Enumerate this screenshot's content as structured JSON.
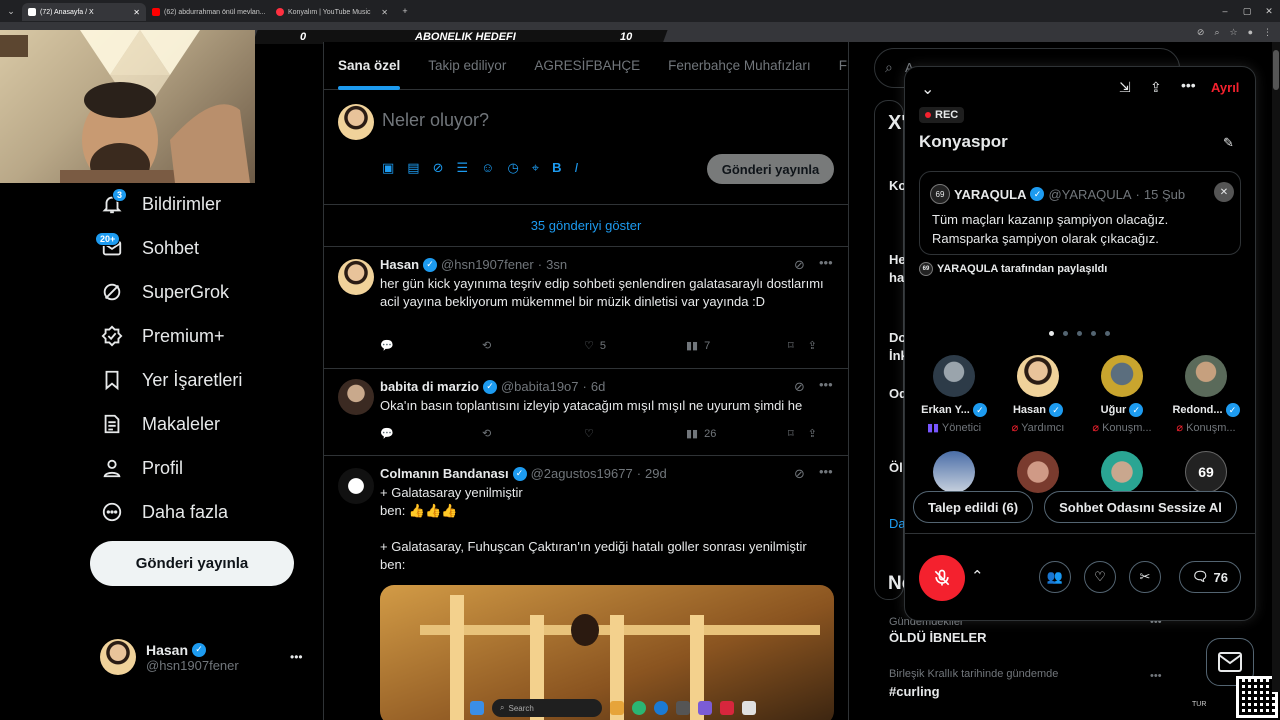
{
  "browser": {
    "tabs": [
      {
        "label": "(72) Anasayfa / X",
        "color": "#ffffff",
        "active": true
      },
      {
        "label": "(62) abdurrahman önül mevlan...",
        "color": "#ff0000",
        "active": false
      },
      {
        "label": "Konyalım | YouTube Music",
        "color": "#ff3040",
        "active": false
      }
    ]
  },
  "overlay": {
    "goal_left": "0",
    "goal_title": "ABONELIK HEDEFI",
    "goal_right": "10"
  },
  "nav": {
    "items": [
      {
        "label": "Bildirimler",
        "icon": "bell-icon",
        "badge": "3"
      },
      {
        "label": "Sohbet",
        "icon": "mail-icon",
        "badge": "20+"
      },
      {
        "label": "SuperGrok",
        "icon": "grok-icon",
        "badge": ""
      },
      {
        "label": "Premium+",
        "icon": "premium-icon",
        "badge": ""
      },
      {
        "label": "Yer İşaretleri",
        "icon": "bookmark-icon",
        "badge": ""
      },
      {
        "label": "Makaleler",
        "icon": "article-icon",
        "badge": ""
      },
      {
        "label": "Profil",
        "icon": "person-icon",
        "badge": ""
      },
      {
        "label": "Daha fazla",
        "icon": "more-circle-icon",
        "badge": ""
      }
    ],
    "post_button": "Gönderi yayınla",
    "account": {
      "name": "Hasan",
      "handle": "@hsn1907fener",
      "more": "•••"
    }
  },
  "main": {
    "tabs": [
      "Sana özel",
      "Takip ediliyor",
      "AGRESİFBAHÇE",
      "Fenerbahçe Muhafızları",
      "FE"
    ],
    "composer": {
      "placeholder": "Neler oluyor?",
      "post_button": "Gönderi yayınla"
    },
    "show_more": "35 gönderiyi göster",
    "posts": [
      {
        "name": "Hasan",
        "handle": "@hsn1907fener",
        "time": "3sn",
        "text": "her gün kick yayınıma teşriv edip sohbeti şenlendiren galatasaraylı dostlarımı acil yayına bekliyorum mükemmel bir müzik dinletisi var yayında :D",
        "likes": "5",
        "views": "7"
      },
      {
        "name": "babita di marzio",
        "handle": "@babita19o7",
        "time": "6d",
        "text": "Oka'ın basın toplantısını izleyip yatacağım mışıl mışıl ne uyurum şimdi he",
        "likes": "",
        "views": "26"
      },
      {
        "name": "Colmanın Bandanası",
        "handle": "@2agustos19677",
        "time": "29d",
        "text": "+ Galatasaray yenilmiştir\nben: 👍👍👍\n\n+ Galatasaray, Fuhuşcan Çaktıran'ın yediği hatalı goller sonrası yenilmiştir\nben:",
        "likes": "",
        "views": ""
      }
    ]
  },
  "right": {
    "search_placeholder": "A",
    "trend_header": "X'",
    "snippets": [
      "Ko",
      "He",
      "ha",
      "Do",
      "İnk",
      "Od",
      "Öl",
      "Da",
      "Ne"
    ],
    "trends": [
      {
        "context": "Gündemdekiler",
        "title": "ÖLDÜ İBNELER"
      },
      {
        "context": "Birleşik Krallık tarihinde gündemde",
        "title": "#curling"
      }
    ]
  },
  "space": {
    "leave": "Ayrıl",
    "rec": "REC",
    "title": "Konyaspor",
    "pinned": {
      "name": "YARAQULA",
      "handle": "@YARAQULA",
      "date": "15 Şub",
      "text": "Tüm maçları kazanıp şampiyon olacağız.\nRamsparka şampiyon olarak çıkacağız.",
      "shared_by": "YARAQULA tarafından paylaşıldı"
    },
    "speakers": [
      {
        "name": "Erkan Y...",
        "role": "Yönetici"
      },
      {
        "name": "Hasan",
        "role": "Yardımcı"
      },
      {
        "name": "Uğur",
        "role": "Konuşm..."
      },
      {
        "name": "Redond...",
        "role": "Konuşm..."
      }
    ],
    "requested": "Talep edildi (6)",
    "mute_room": "Sohbet Odasını Sessize Al",
    "comments": "76"
  },
  "taskbar": {
    "search": "Search",
    "lang": "TUR"
  }
}
